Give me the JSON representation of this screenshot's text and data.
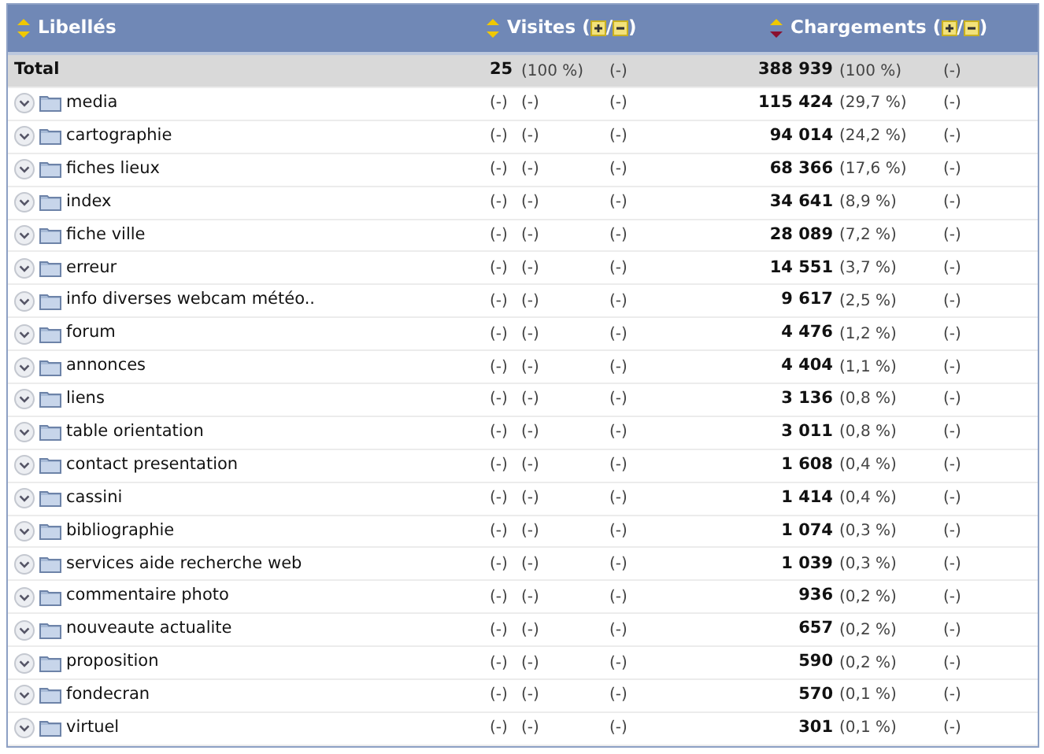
{
  "columns": [
    {
      "label": "Libellés",
      "sorted": false
    },
    {
      "label": "Visites",
      "sorted": false,
      "open": "(",
      "sep": "/",
      "close": ")"
    },
    {
      "label": "Chargements",
      "sorted": true,
      "open": "(",
      "sep": "/",
      "close": ")"
    }
  ],
  "total": {
    "label": "Total",
    "visits": "25",
    "visits_pct": "(100 %)",
    "visits_extra": "(-)",
    "loads": "388 939",
    "loads_pct": "(100 %)",
    "loads_extra": "(-)"
  },
  "rows": [
    {
      "label": "media",
      "visits": "(-)",
      "visits_pct": "(-)",
      "visits_extra": "(-)",
      "loads": "115 424",
      "loads_pct": "(29,7 %)",
      "loads_extra": "(-)"
    },
    {
      "label": "cartographie",
      "visits": "(-)",
      "visits_pct": "(-)",
      "visits_extra": "(-)",
      "loads": "94 014",
      "loads_pct": "(24,2 %)",
      "loads_extra": "(-)"
    },
    {
      "label": "fiches lieux",
      "visits": "(-)",
      "visits_pct": "(-)",
      "visits_extra": "(-)",
      "loads": "68 366",
      "loads_pct": "(17,6 %)",
      "loads_extra": "(-)"
    },
    {
      "label": "index",
      "visits": "(-)",
      "visits_pct": "(-)",
      "visits_extra": "(-)",
      "loads": "34 641",
      "loads_pct": "(8,9 %)",
      "loads_extra": "(-)"
    },
    {
      "label": "fiche ville",
      "visits": "(-)",
      "visits_pct": "(-)",
      "visits_extra": "(-)",
      "loads": "28 089",
      "loads_pct": "(7,2 %)",
      "loads_extra": "(-)"
    },
    {
      "label": "erreur",
      "visits": "(-)",
      "visits_pct": "(-)",
      "visits_extra": "(-)",
      "loads": "14 551",
      "loads_pct": "(3,7 %)",
      "loads_extra": "(-)"
    },
    {
      "label": "info diverses webcam météo..",
      "visits": "(-)",
      "visits_pct": "(-)",
      "visits_extra": "(-)",
      "loads": "9 617",
      "loads_pct": "(2,5 %)",
      "loads_extra": "(-)"
    },
    {
      "label": "forum",
      "visits": "(-)",
      "visits_pct": "(-)",
      "visits_extra": "(-)",
      "loads": "4 476",
      "loads_pct": "(1,2 %)",
      "loads_extra": "(-)"
    },
    {
      "label": "annonces",
      "visits": "(-)",
      "visits_pct": "(-)",
      "visits_extra": "(-)",
      "loads": "4 404",
      "loads_pct": "(1,1 %)",
      "loads_extra": "(-)"
    },
    {
      "label": "liens",
      "visits": "(-)",
      "visits_pct": "(-)",
      "visits_extra": "(-)",
      "loads": "3 136",
      "loads_pct": "(0,8 %)",
      "loads_extra": "(-)"
    },
    {
      "label": "table orientation",
      "visits": "(-)",
      "visits_pct": "(-)",
      "visits_extra": "(-)",
      "loads": "3 011",
      "loads_pct": "(0,8 %)",
      "loads_extra": "(-)"
    },
    {
      "label": "contact presentation",
      "visits": "(-)",
      "visits_pct": "(-)",
      "visits_extra": "(-)",
      "loads": "1 608",
      "loads_pct": "(0,4 %)",
      "loads_extra": "(-)"
    },
    {
      "label": "cassini",
      "visits": "(-)",
      "visits_pct": "(-)",
      "visits_extra": "(-)",
      "loads": "1 414",
      "loads_pct": "(0,4 %)",
      "loads_extra": "(-)"
    },
    {
      "label": "bibliographie",
      "visits": "(-)",
      "visits_pct": "(-)",
      "visits_extra": "(-)",
      "loads": "1 074",
      "loads_pct": "(0,3 %)",
      "loads_extra": "(-)"
    },
    {
      "label": "services aide recherche web",
      "visits": "(-)",
      "visits_pct": "(-)",
      "visits_extra": "(-)",
      "loads": "1 039",
      "loads_pct": "(0,3 %)",
      "loads_extra": "(-)"
    },
    {
      "label": "commentaire photo",
      "visits": "(-)",
      "visits_pct": "(-)",
      "visits_extra": "(-)",
      "loads": "936",
      "loads_pct": "(0,2 %)",
      "loads_extra": "(-)"
    },
    {
      "label": "nouveaute actualite",
      "visits": "(-)",
      "visits_pct": "(-)",
      "visits_extra": "(-)",
      "loads": "657",
      "loads_pct": "(0,2 %)",
      "loads_extra": "(-)"
    },
    {
      "label": "proposition",
      "visits": "(-)",
      "visits_pct": "(-)",
      "visits_extra": "(-)",
      "loads": "590",
      "loads_pct": "(0,2 %)",
      "loads_extra": "(-)"
    },
    {
      "label": "fondecran",
      "visits": "(-)",
      "visits_pct": "(-)",
      "visits_extra": "(-)",
      "loads": "570",
      "loads_pct": "(0,1 %)",
      "loads_extra": "(-)"
    },
    {
      "label": "virtuel",
      "visits": "(-)",
      "visits_pct": "(-)",
      "visits_extra": "(-)",
      "loads": "301",
      "loads_pct": "(0,1 %)",
      "loads_extra": "(-)"
    }
  ]
}
